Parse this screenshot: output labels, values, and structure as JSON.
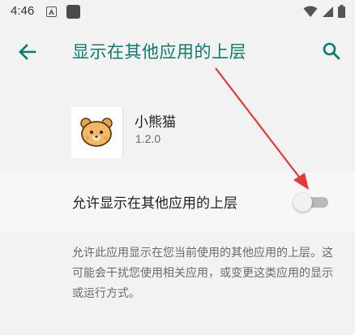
{
  "status_bar": {
    "time": "4:46"
  },
  "header": {
    "title": "显示在其他应用的上层",
    "back_icon": "arrow-back-icon",
    "search_icon": "search-icon"
  },
  "app": {
    "name": "小熊猫",
    "version": "1.2.0"
  },
  "setting": {
    "label": "允许显示在其他应用的上层",
    "enabled": false
  },
  "description": "允许此应用显示在您当前使用的其他应用的上层。这可能会干扰您使用相关应用，或变更这类应用的显示或运行方式。",
  "colors": {
    "accent": "#0c7a6e",
    "annotation_arrow": "#e53935",
    "background": "#f2f2f2"
  }
}
